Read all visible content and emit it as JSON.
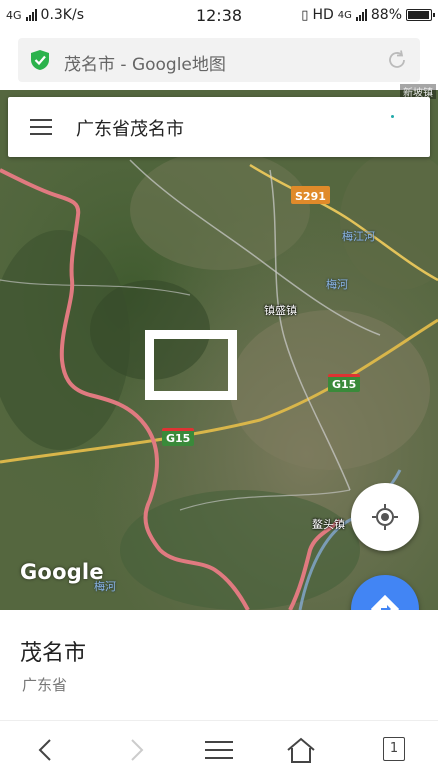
{
  "status_bar": {
    "network": "4G",
    "speed": "0.3K/s",
    "time": "12:38",
    "hd": "HD",
    "network_right": "4G",
    "battery": "88%"
  },
  "browser": {
    "url_title": "茂名市 - Google地图"
  },
  "map": {
    "search_text": "广东省茂名市",
    "corner_label": "新坡镇",
    "roads": [
      "S291",
      "G15",
      "G15"
    ],
    "places": [
      "镇盛镇",
      "鳌头镇"
    ],
    "rivers": [
      "梅江河",
      "梅河",
      "梅河"
    ],
    "logo": "Google"
  },
  "info": {
    "title": "茂名市",
    "subtitle": "广东省"
  },
  "bottom_nav": {
    "tab_count": "1"
  },
  "colors": {
    "accent": "#4285f4",
    "shield_green": "#2bb24c",
    "boundary": "#e07a80"
  },
  "icons": [
    "shield-check-icon",
    "reload-icon",
    "menu-icon",
    "my-location-icon",
    "directions-icon",
    "back-icon",
    "forward-icon",
    "menu-lines-icon",
    "home-icon",
    "tabs-icon"
  ]
}
